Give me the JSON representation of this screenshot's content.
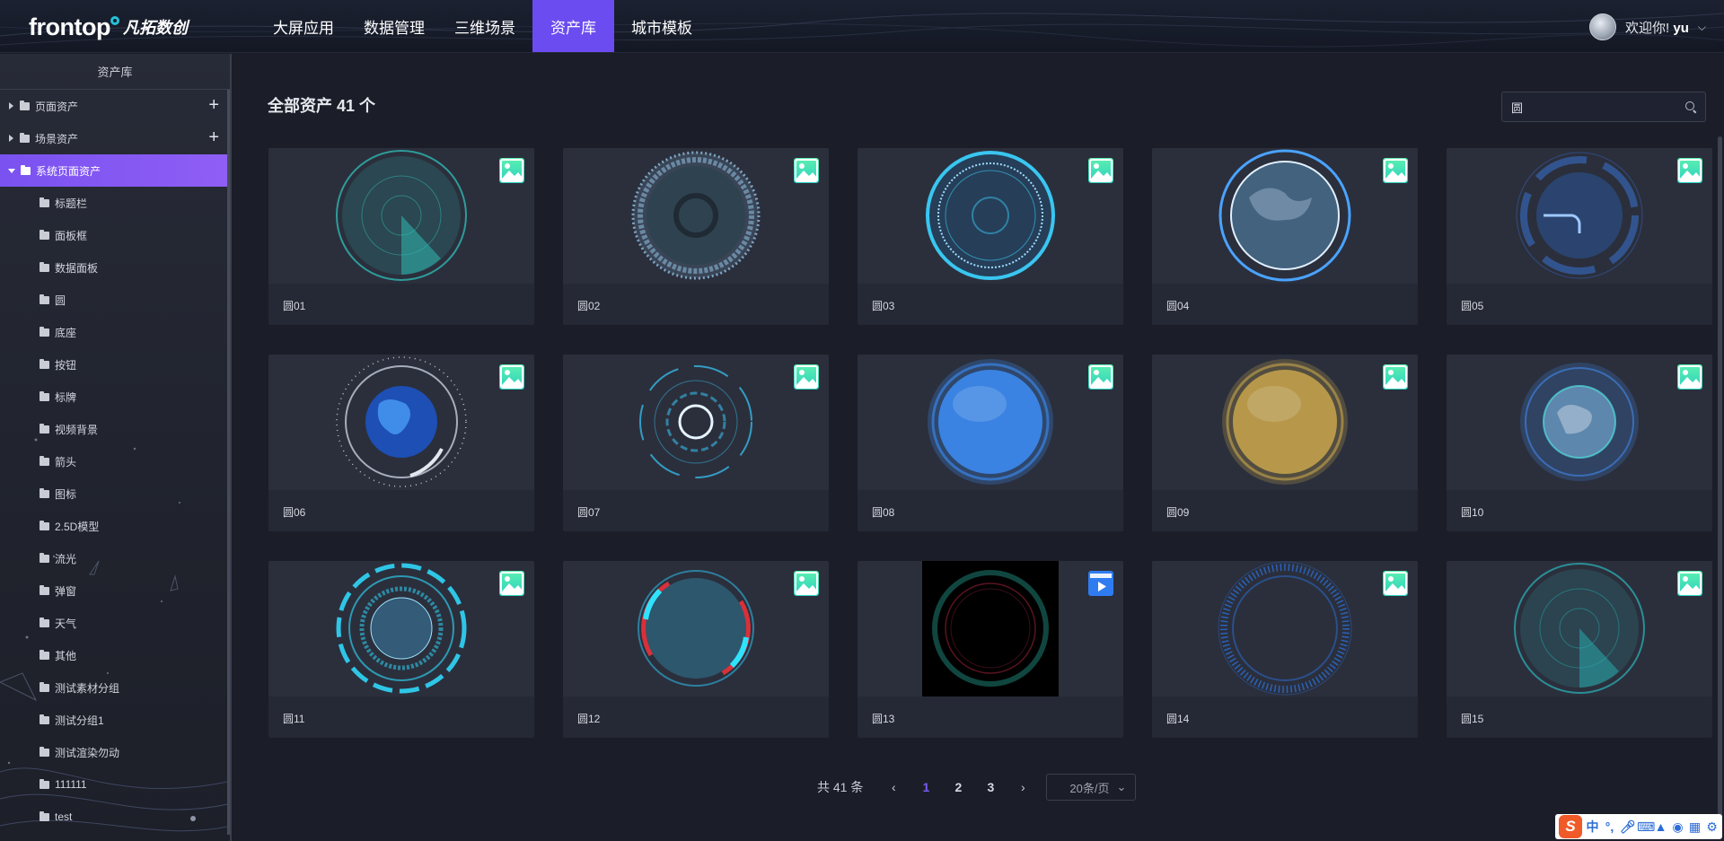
{
  "header": {
    "logo_word": "frontop",
    "logo_cn": "凡拓数创",
    "nav": [
      {
        "label": "大屏应用",
        "active": false
      },
      {
        "label": "数据管理",
        "active": false
      },
      {
        "label": "三维场景",
        "active": false
      },
      {
        "label": "资产库",
        "active": true
      },
      {
        "label": "城市模板",
        "active": false
      }
    ],
    "welcome": "欢迎你!",
    "username": "yu",
    "caret_icon": "chevron-down-icon"
  },
  "sidebar": {
    "title": "资产库",
    "groups": [
      {
        "label": "页面资产",
        "expanded": false,
        "active": false,
        "has_add": true
      },
      {
        "label": "场景资产",
        "expanded": false,
        "active": false,
        "has_add": true
      },
      {
        "label": "系统页面资产",
        "expanded": true,
        "active": true,
        "has_add": false
      }
    ],
    "children": [
      "标题栏",
      "面板框",
      "数据面板",
      "圆",
      "底座",
      "按钮",
      "标牌",
      "视频背景",
      "箭头",
      "图标",
      "2.5D模型",
      "流光",
      "弹窗",
      "天气",
      "其他",
      "测试素材分组",
      "测试分组1",
      "测试渲染勿动",
      "111111",
      "test"
    ]
  },
  "main": {
    "title": "全部资产 41 个",
    "search": {
      "value": "圆",
      "placeholder": ""
    },
    "assets": [
      {
        "label": "圆01",
        "type": "image",
        "style": "radar",
        "color": "#2fb8b2"
      },
      {
        "label": "圆02",
        "type": "image",
        "style": "dial",
        "color": "#7fa6c4"
      },
      {
        "label": "圆03",
        "type": "image",
        "style": "glow-ring",
        "color": "#39c6f0"
      },
      {
        "label": "圆04",
        "type": "image",
        "style": "globe",
        "color": "#4aa3ff"
      },
      {
        "label": "圆05",
        "type": "image",
        "style": "arc",
        "color": "#3a79e0"
      },
      {
        "label": "圆06",
        "type": "image",
        "style": "earth",
        "color": "#2f7ff0"
      },
      {
        "label": "圆07",
        "type": "image",
        "style": "hud",
        "color": "#37b9e6"
      },
      {
        "label": "圆08",
        "type": "image",
        "style": "sphere",
        "color": "#3c8ef7"
      },
      {
        "label": "圆09",
        "type": "image",
        "style": "sphere",
        "color": "#c9a64c"
      },
      {
        "label": "圆10",
        "type": "image",
        "style": "earth-sphere",
        "color": "#3f7fd8"
      },
      {
        "label": "圆11",
        "type": "image",
        "style": "tech-ring",
        "color": "#2fc6e6"
      },
      {
        "label": "圆12",
        "type": "image",
        "style": "red-hud",
        "color": "#2fb6e0"
      },
      {
        "label": "圆13",
        "type": "video",
        "style": "dark-ring",
        "color": "#1f8c7e"
      },
      {
        "label": "圆14",
        "type": "image",
        "style": "tick-ring",
        "color": "#2b6fd6"
      },
      {
        "label": "圆15",
        "type": "image",
        "style": "radar",
        "color": "#2aa8ac"
      }
    ]
  },
  "pagination": {
    "total": "共 41 条",
    "pages": [
      "1",
      "2",
      "3"
    ],
    "current": "1",
    "page_size": "20条/页",
    "prev_icon": "chevron-left-icon",
    "next_icon": "chevron-right-icon"
  },
  "ime": {
    "logo": "S",
    "items": [
      "中",
      "°,",
      "mic",
      "keyboard",
      "shirt",
      "gamepad",
      "grid",
      "gear"
    ]
  }
}
